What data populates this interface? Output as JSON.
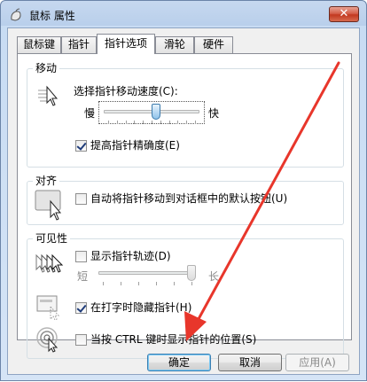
{
  "window": {
    "title": "鼠标 属性",
    "close_glyph": "✕"
  },
  "tabs": [
    {
      "label": "鼠标键"
    },
    {
      "label": "指针"
    },
    {
      "label": "指针选项"
    },
    {
      "label": "滑轮"
    },
    {
      "label": "硬件"
    }
  ],
  "motion": {
    "title": "移动",
    "speed_label": "选择指针移动速度(C):",
    "slow": "慢",
    "fast": "快",
    "speed_value": 0.55,
    "precision_label": "提高指针精确度(E)",
    "precision_checked": true
  },
  "snap": {
    "title": "对齐",
    "snap_label": "自动将指针移动到对话框中的默认按钮(U)",
    "snap_checked": false
  },
  "visibility": {
    "title": "可见性",
    "trails_label": "显示指针轨迹(D)",
    "trails_checked": false,
    "short": "短",
    "long": "长",
    "trails_value": 1.0,
    "hide_label": "在打字时隐藏指针(H)",
    "hide_checked": true,
    "ctrl_label": "当按 CTRL 键时显示指针的位置(S)",
    "ctrl_checked": false
  },
  "buttons": {
    "ok": "确定",
    "cancel": "取消",
    "apply": "应用(A)"
  },
  "colors": {
    "annotation_arrow": "#e8362b",
    "title_bar": "#b9cfeb",
    "close_button": "#c2391f"
  },
  "icons": [
    "mouse-icon",
    "pointer-speed-icon",
    "snap-to-button-icon",
    "pointer-trails-icon",
    "hide-while-typing-icon",
    "ctrl-locate-icon"
  ]
}
